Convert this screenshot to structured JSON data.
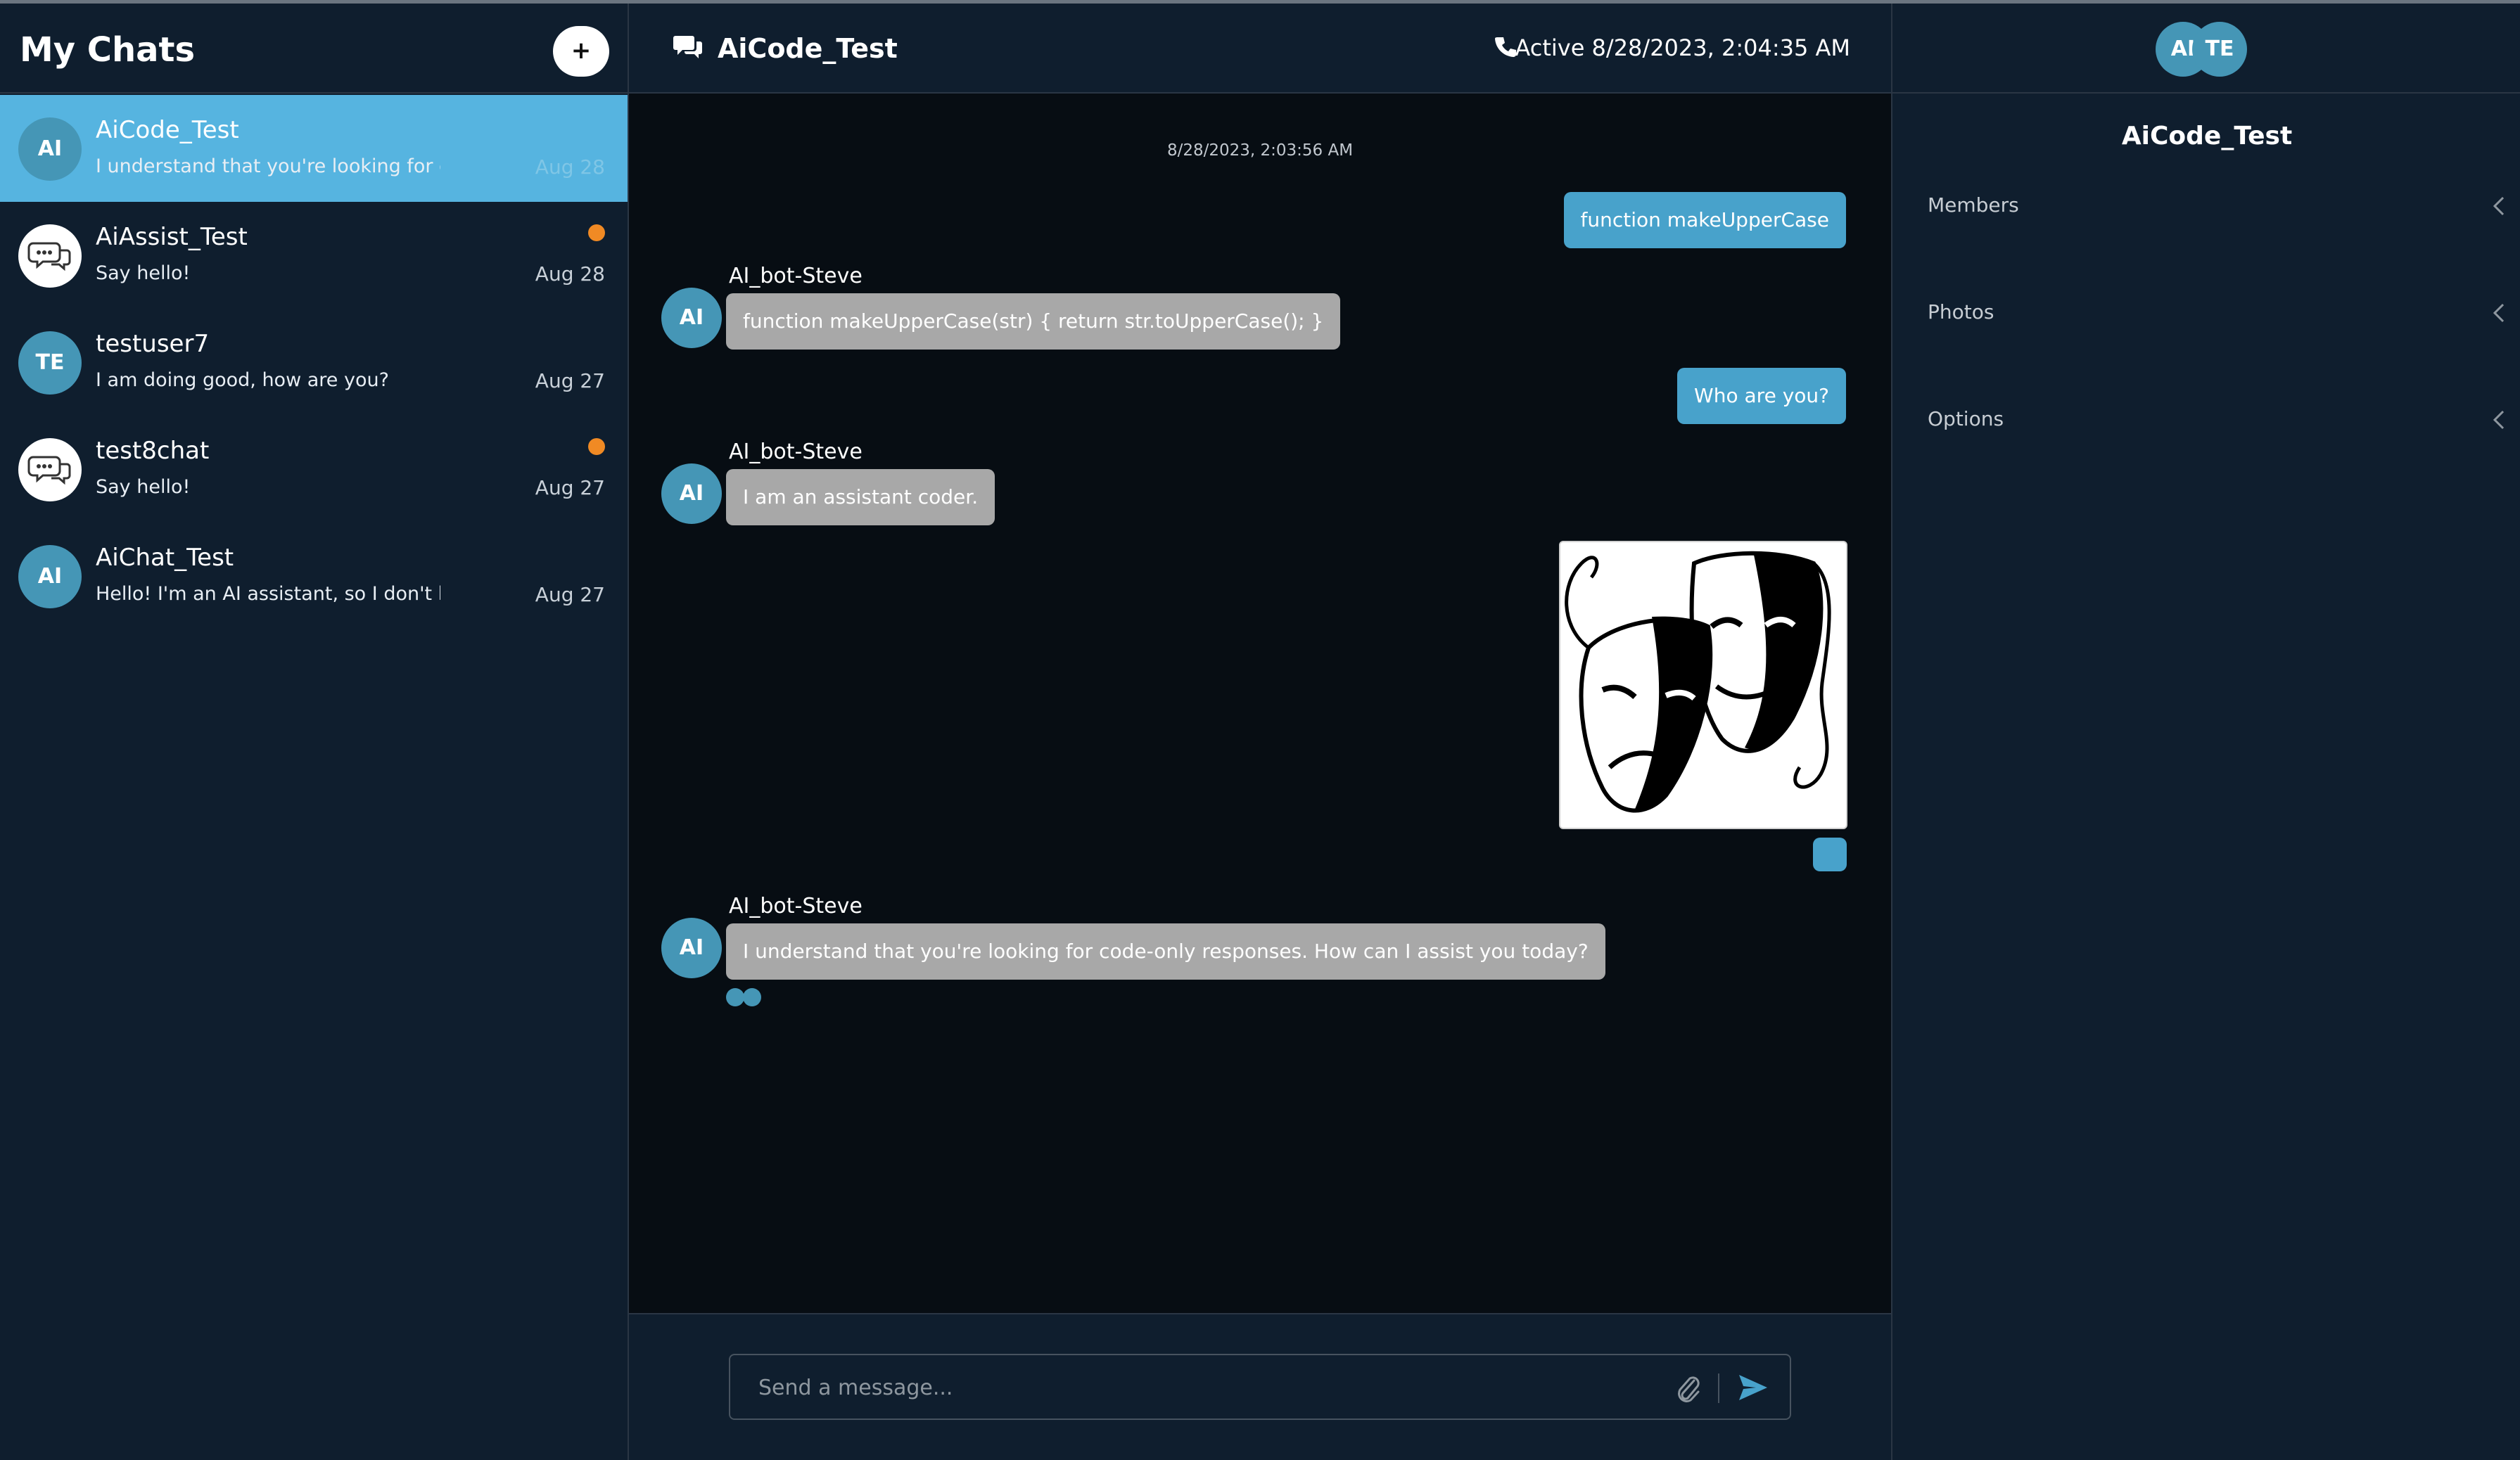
{
  "sidebar": {
    "title": "My Chats",
    "new_chat_label": "+",
    "chats": [
      {
        "avatar": "AI",
        "name": "AiCode_Test",
        "preview": "I understand that you're looking for code-only responses. How can I assist you today?",
        "date": "Aug 28",
        "active": true,
        "unread": false
      },
      {
        "avatar": "chat-bubbles-icon",
        "name": "AiAssist_Test",
        "preview": "Say hello!",
        "date": "Aug 28",
        "active": false,
        "unread": true
      },
      {
        "avatar": "TE",
        "name": "testuser7",
        "preview": "I am doing good, how are you?",
        "date": "Aug 27",
        "active": false,
        "unread": false
      },
      {
        "avatar": "chat-bubbles-icon",
        "name": "test8chat",
        "preview": "Say hello!",
        "date": "Aug 27",
        "active": false,
        "unread": true
      },
      {
        "avatar": "AI",
        "name": "AiChat_Test",
        "preview": "Hello! I'm an AI assistant, so I don't have feelings",
        "date": "Aug 27",
        "active": false,
        "unread": false
      }
    ]
  },
  "header": {
    "title": "AiCode_Test",
    "status": "Active 8/28/2023, 2:04:35 AM"
  },
  "messages": {
    "timestamp": "8/28/2023, 2:03:56 AM",
    "m1_out": "function makeUpperCase",
    "m2_sender": "AI_bot-Steve",
    "m2_avatar": "AI",
    "m2_in": "function makeUpperCase(str) { return str.toUpperCase(); }",
    "m3_out": "Who are you?",
    "m4_sender": "AI_bot-Steve",
    "m4_avatar": "AI",
    "m4_in": "I am an assistant coder.",
    "m5_image": "theater-masks-image",
    "m6_sender": "AI_bot-Steve",
    "m6_avatar": "AI",
    "m6_in": "I understand that you're looking for code-only responses. How can I assist you today?"
  },
  "composer": {
    "placeholder": "Send a message..."
  },
  "details": {
    "members_avatars": [
      "AI",
      "TE"
    ],
    "title": "AiCode_Test",
    "sections": [
      "Members",
      "Photos",
      "Options"
    ]
  },
  "colors": {
    "accent": "#48a2cb",
    "active_chat": "#56b4e0",
    "unread": "#f08a24",
    "incoming_bubble": "#a8a8a8"
  }
}
